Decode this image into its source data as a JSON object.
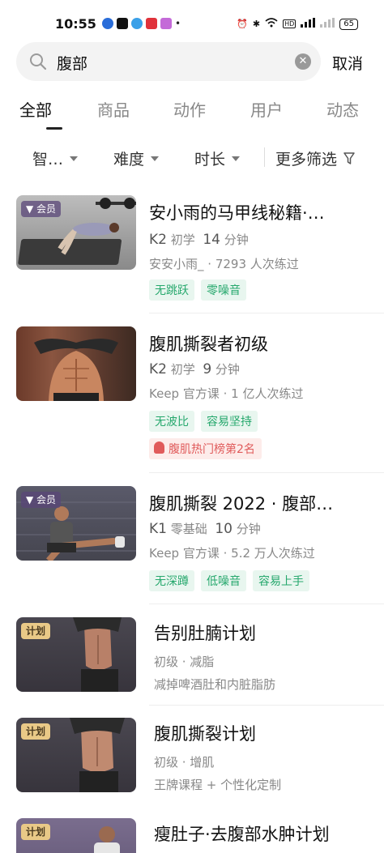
{
  "status_bar": {
    "time": "10:55",
    "battery": "65",
    "right_icons": [
      "alarm-icon",
      "bluetooth-icon",
      "wifi-icon",
      "hd-icon",
      "signal-5g-icon",
      "signal-icon"
    ]
  },
  "search": {
    "query": "腹部",
    "cancel_label": "取消"
  },
  "tabs": [
    {
      "label": "全部",
      "active": true
    },
    {
      "label": "商品",
      "active": false
    },
    {
      "label": "动作",
      "active": false
    },
    {
      "label": "用户",
      "active": false
    },
    {
      "label": "动态",
      "active": false
    }
  ],
  "filters": {
    "smart": "智…",
    "difficulty": "难度",
    "duration": "时长",
    "more": "更多筛选"
  },
  "results": [
    {
      "badge": "会员",
      "title": "安小雨的马甲线秘籍·…",
      "level": "K2",
      "level_text": "初学",
      "minutes": "14",
      "minutes_unit": "分钟",
      "author": "安安小雨_",
      "practiced": "· 7293 人次练过",
      "tags": [
        "无跳跃",
        "零噪音"
      ]
    },
    {
      "badge": "",
      "title": "腹肌撕裂者初级",
      "level": "K2",
      "level_text": "初学",
      "minutes": "9",
      "minutes_unit": "分钟",
      "author": "Keep 官方课",
      "practiced": "· 1 亿人次练过",
      "tags": [
        "无波比",
        "容易坚持"
      ],
      "rank": "腹肌热门榜第2名"
    },
    {
      "badge": "会员",
      "title": "腹肌撕裂 2022 · 腹部…",
      "level": "K1",
      "level_text": "零基础",
      "minutes": "10",
      "minutes_unit": "分钟",
      "author": "Keep 官方课",
      "practiced": "· 5.2 万人次练过",
      "tags": [
        "无深蹲",
        "低噪音",
        "容易上手"
      ]
    },
    {
      "badge": "计划",
      "title": "告别肚腩计划",
      "meta": "初级 · 减脂",
      "desc": "减掉啤酒肚和内脏脂肪"
    },
    {
      "badge": "计划",
      "title": "腹肌撕裂计划",
      "meta": "初级 · 增肌",
      "desc": "王牌课程 + 个性化定制"
    },
    {
      "badge": "计划",
      "title": "瘦肚子·去腹部水肿计划"
    }
  ],
  "colors": {
    "tag_green": "#26a86d",
    "tag_bg": "#e8f6ef",
    "rank_red": "#e05b5b",
    "plan_badge": "#e9c987"
  }
}
